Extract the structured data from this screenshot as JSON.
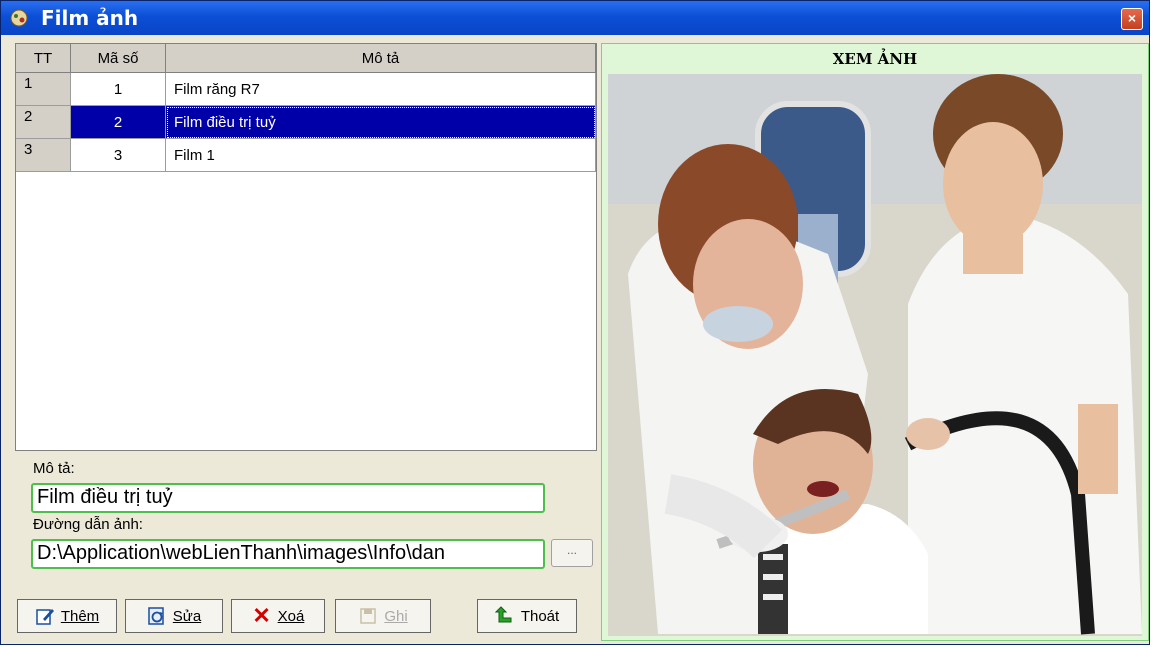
{
  "window": {
    "title": "Film ảnh",
    "close_symbol": "×"
  },
  "grid": {
    "columns": [
      "TT",
      "Mã số",
      "Mô tả"
    ],
    "rows": [
      {
        "tt": "1",
        "ma": "1",
        "mota": "Film  răng R7"
      },
      {
        "tt": "2",
        "ma": "2",
        "mota": "Film điều trị tuỷ"
      },
      {
        "tt": "3",
        "ma": "3",
        "mota": "Film 1"
      }
    ],
    "selected_row": 2
  },
  "form": {
    "mota_label": "Mô tả:",
    "mota_value": "Film điều trị tuỷ",
    "path_label": "Đường dẫn ảnh:",
    "path_value": "D:\\Application\\webLienThanh\\images\\Info\\dan",
    "browse_label": "..."
  },
  "buttons": {
    "them": "Thêm",
    "sua": "Sửa",
    "xoa": "Xoá",
    "ghi": "Ghi",
    "thoat": "Thoát"
  },
  "preview": {
    "header": "XEM ẢNH"
  },
  "colors": {
    "accent": "#0b4fd6",
    "selection": "#0000a8",
    "field_border": "#4cbf4c",
    "preview_bg": "#dff7d6"
  }
}
